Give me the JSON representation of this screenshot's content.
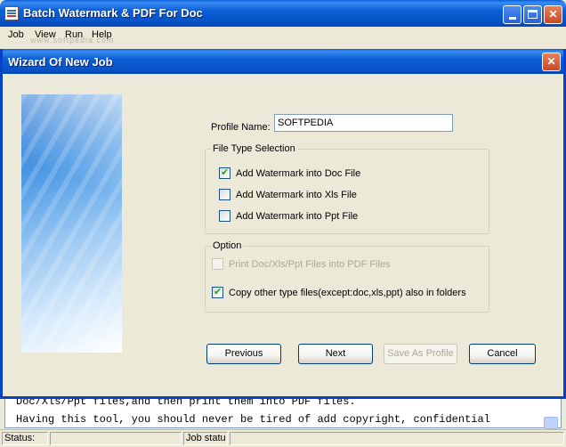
{
  "app": {
    "title": "Batch Watermark & PDF For Doc",
    "watermark_text": "www.softpedia.com"
  },
  "menu": [
    "Job",
    "View",
    "Run",
    "Help"
  ],
  "dialog": {
    "title": "Wizard Of New Job",
    "profile_label": "Profile Name:",
    "profile_value": "SOFTPEDIA",
    "file_type_group": {
      "legend": "File Type Selection",
      "items": [
        {
          "label": "Add Watermark into Doc File",
          "checked": true
        },
        {
          "label": "Add Watermark into Xls File",
          "checked": false
        },
        {
          "label": "Add Watermark into Ppt File",
          "checked": false
        }
      ]
    },
    "option_group": {
      "legend": "Option",
      "items": [
        {
          "label": "Print Doc/Xls/Ppt Files into PDF Files",
          "checked": false,
          "disabled": true
        },
        {
          "label": "Copy other type files(except:doc,xls,ppt) also in folders",
          "checked": true,
          "disabled": false
        }
      ]
    },
    "buttons": {
      "previous": "Previous",
      "next": "Next",
      "save_as_profile": "Save As Profile",
      "cancel": "Cancel"
    }
  },
  "document": {
    "line1": "Doc/Xls/Ppt files,and then print them into PDF files.",
    "line2": "    Having  this  tool,  you  should  never  be  tired  of  add  copyright,  confidential"
  },
  "status": {
    "label": "Status:",
    "job_status": "Job statu"
  }
}
